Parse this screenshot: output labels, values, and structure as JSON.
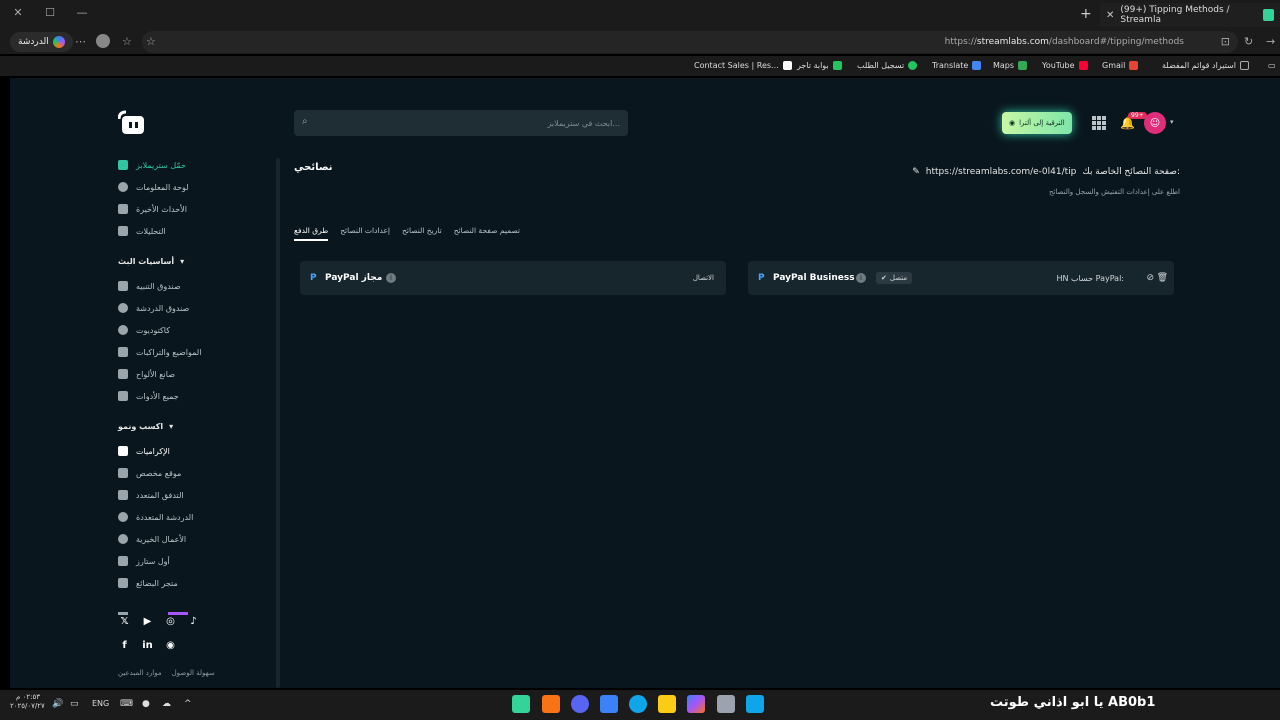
{
  "browser": {
    "tab_title": "(99+) Tipping Methods / Streamla",
    "chat_label": "الدردشة",
    "url_prefix": "https://",
    "url_host": "streamlabs.com",
    "url_path": "/dashboard#/tipping/methods",
    "bookmarks": [
      {
        "label": "استيراد قوائم المفضلة"
      },
      {
        "label": "Gmail"
      },
      {
        "label": "YouTube"
      },
      {
        "label": "Maps"
      },
      {
        "label": "Translate"
      },
      {
        "label": "تسجيل الطلب"
      },
      {
        "label": "بوابة تاجر"
      },
      {
        "label": "Contact Sales | Res..."
      }
    ]
  },
  "header": {
    "search_placeholder": "ابحث في ستريملابز...",
    "upgrade_label": "الترقية إلى ألترا",
    "notif_count": "99+"
  },
  "sidebar": {
    "main_items": [
      {
        "label": "حمّل ستريملابز"
      },
      {
        "label": "لوحة المعلومات"
      },
      {
        "label": "الأحداث الأخيرة"
      },
      {
        "label": "التحليلات"
      }
    ],
    "section1_title": "أساسيات البث",
    "section1_items": [
      {
        "label": "صندوق التنبيه"
      },
      {
        "label": "صندوق الدردشة"
      },
      {
        "label": "كاكتوديوت"
      },
      {
        "label": "المواضيع والتراكبات"
      },
      {
        "label": "صانع الألواح"
      },
      {
        "label": "جميع الأدوات"
      }
    ],
    "section2_title": "اكسب ونمو",
    "section2_items": [
      {
        "label": "الإكراميات"
      },
      {
        "label": "موقع مخصص"
      },
      {
        "label": "التدفق المتعدد"
      },
      {
        "label": "الدردشة المتعددة"
      },
      {
        "label": "الأعمال الخيرية"
      },
      {
        "label": "أول ستارز"
      },
      {
        "label": "متجر البضائع"
      }
    ],
    "footer_links": [
      "سهولة الوصول",
      "موارد المبدعين"
    ]
  },
  "main": {
    "title": "نصائحي",
    "page_url": "https://streamlabs.com/e-0l41/tip",
    "page_url_label": "صفحة النصائح الخاصة بك:",
    "subtitle": "اطلع على إعدادات التفتيش والسجل والنصائح",
    "tabs": [
      {
        "label": "تصميم صفحة النصائح"
      },
      {
        "label": "تاريخ النصائح"
      },
      {
        "label": "إعدادات النصائح"
      },
      {
        "label": "طرق الدفع"
      }
    ],
    "method_right": {
      "name": "PayPal Business",
      "status": "متصل",
      "account": "HN حساب PayPal:"
    },
    "method_left": {
      "name": "PayPal مجاز",
      "action": "الاتصال"
    }
  },
  "taskbar": {
    "time": "٠٢:٥٣ م",
    "date": "٢٠٢٥/٠٧/٢٧",
    "lang": "ENG",
    "overlay_text": "يا ابو اذاني طوتت  AB0b1"
  }
}
